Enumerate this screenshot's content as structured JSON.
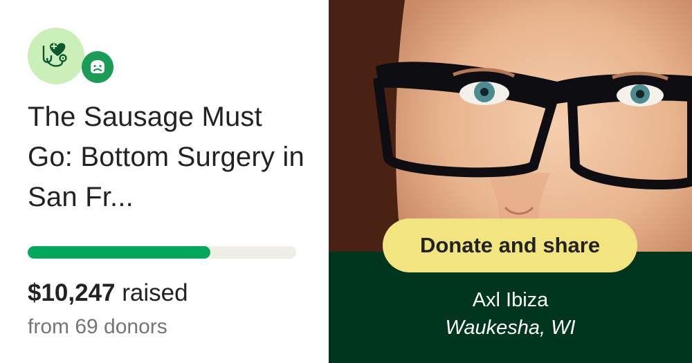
{
  "campaign": {
    "category_icon": "medical-heart-stethoscope-icon",
    "badge_icon": "gofundme-logo-icon",
    "title": "The Sausage Must Go: Bottom Surgery in San Fr...",
    "progress_fraction": 0.68,
    "raised_amount": "$10,247",
    "raised_label": "raised",
    "donors_text": "from 69 donors"
  },
  "organizer": {
    "name": "Axl Ibiza",
    "location": "Waukesha, WI"
  },
  "cta": {
    "label": "Donate and share"
  },
  "colors": {
    "brand_green": "#02a95c",
    "dark_green": "#01361e",
    "light_green": "#cbefb9",
    "cta_yellow": "#f2e57f"
  }
}
